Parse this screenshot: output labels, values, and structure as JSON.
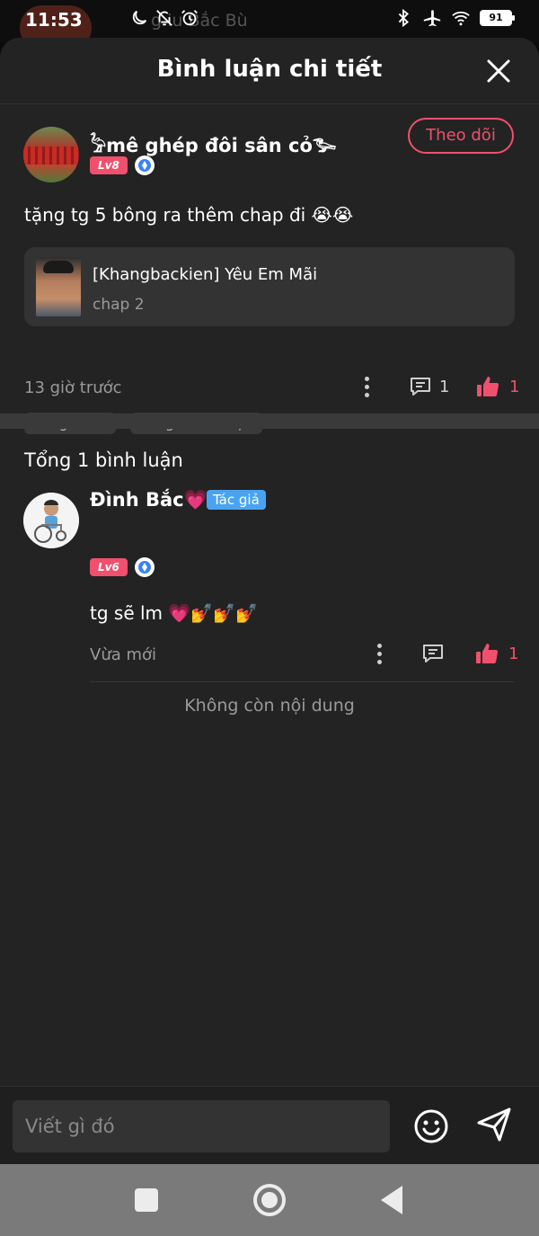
{
  "status_bar": {
    "time": "11:53",
    "battery": "91",
    "background_text": "g iu Bắc Bù"
  },
  "header": {
    "title": "Bình luận chi tiết"
  },
  "main_comment": {
    "username": "𓅦mê ghép đôi sân cỏ𓅧",
    "level": "Lv8",
    "follow_label": "Theo dõi",
    "text": "tặng tg 5 bông ra thêm chap đi 😭😭",
    "reference": {
      "title": "[Khangbackien] Yêu Em Mãi",
      "subtitle": "chap 2"
    },
    "time": "13 giờ trước",
    "reply_count": "1",
    "like_count": "1",
    "tags": [
      "Tác giả like",
      "Tác giả bình luận"
    ]
  },
  "replies_section": {
    "title": "Tổng 1 bình luận",
    "replies": [
      {
        "username": "Đình Bắc💗",
        "author_badge": "Tác giả",
        "level": "Lv6",
        "text": "tg sẽ lm 💗💅💅💅",
        "time": "Vừa mới",
        "like_count": "1"
      }
    ]
  },
  "end_text": "Không còn nội dung",
  "composer": {
    "placeholder": "Viết gì đó"
  },
  "colors": {
    "accent": "#f0506e",
    "author_badge": "#4aa3f0",
    "sheet_bg": "#232323"
  },
  "icons": [
    "moon-icon",
    "bell-off-icon",
    "alarm-icon",
    "bluetooth-icon",
    "airplane-icon",
    "wifi-icon",
    "close-icon",
    "more-vert-icon",
    "comment-icon",
    "thumb-up-icon",
    "emoji-icon",
    "send-icon"
  ]
}
